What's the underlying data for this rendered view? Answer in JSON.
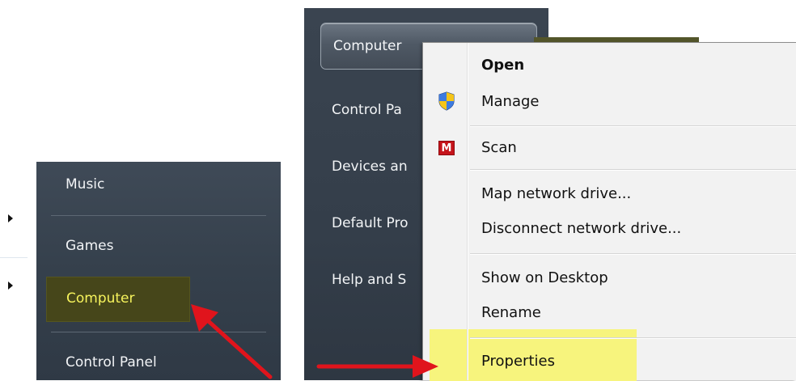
{
  "left_menu": {
    "items": [
      {
        "label": "Music"
      },
      {
        "label": "Games"
      },
      {
        "label": "Computer"
      },
      {
        "label": "Control Panel"
      }
    ]
  },
  "right_menu": {
    "computer_button": "Computer",
    "items": [
      {
        "label": "Control Pa"
      },
      {
        "label": "Devices an"
      },
      {
        "label": "Default Pro"
      },
      {
        "label": "Help and S"
      }
    ]
  },
  "context_menu": {
    "items": [
      {
        "label": "Open"
      },
      {
        "label": "Manage",
        "icon": "uac-shield-icon"
      },
      {
        "label": "Scan",
        "icon": "mcafee-icon",
        "icon_text": "M"
      },
      {
        "label": "Map network drive..."
      },
      {
        "label": "Disconnect network drive..."
      },
      {
        "label": "Show on Desktop"
      },
      {
        "label": "Rename"
      },
      {
        "label": "Properties"
      }
    ]
  },
  "colors": {
    "highlight_yellow": "#f7f47d",
    "start_menu_bg": "#3a4450",
    "selected_text": "#f6f35c",
    "arrow_red": "#e0141c"
  }
}
